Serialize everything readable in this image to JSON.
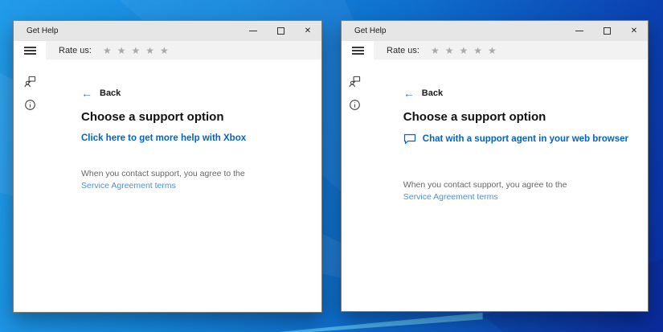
{
  "desktop": {
    "wallpaper_colors": {
      "top_left": "#229ce9",
      "middle": "#0f6fcd",
      "bottom_right": "#0a2ea4",
      "ray_highlight": "#78e1ff"
    }
  },
  "colors": {
    "option_link": "#0063c8",
    "agreement_link": "#4a90d9",
    "back_arrow": "#3579d8",
    "titlebar_bg": "#e6e6e6",
    "ratebar_bg": "#f2f2f2",
    "star": "#a9a9a9"
  },
  "icons": {
    "back_arrow": "←",
    "close_glyph": "✕",
    "star": "★"
  },
  "windows": [
    {
      "title": "Get Help",
      "rate_label": "Rate us:",
      "back_label": "Back",
      "heading": "Choose a support option",
      "option_label": "Click here to get more help with Xbox",
      "agreement_prefix": "When you contact support, you agree to the ",
      "agreement_link": "Service Agreement terms"
    },
    {
      "title": "Get Help",
      "rate_label": "Rate us:",
      "back_label": "Back",
      "heading": "Choose a support option",
      "option_label": "Chat with a support agent in your web browser",
      "agreement_prefix": "When you contact support, you agree to the ",
      "agreement_link": "Service Agreement terms"
    }
  ]
}
